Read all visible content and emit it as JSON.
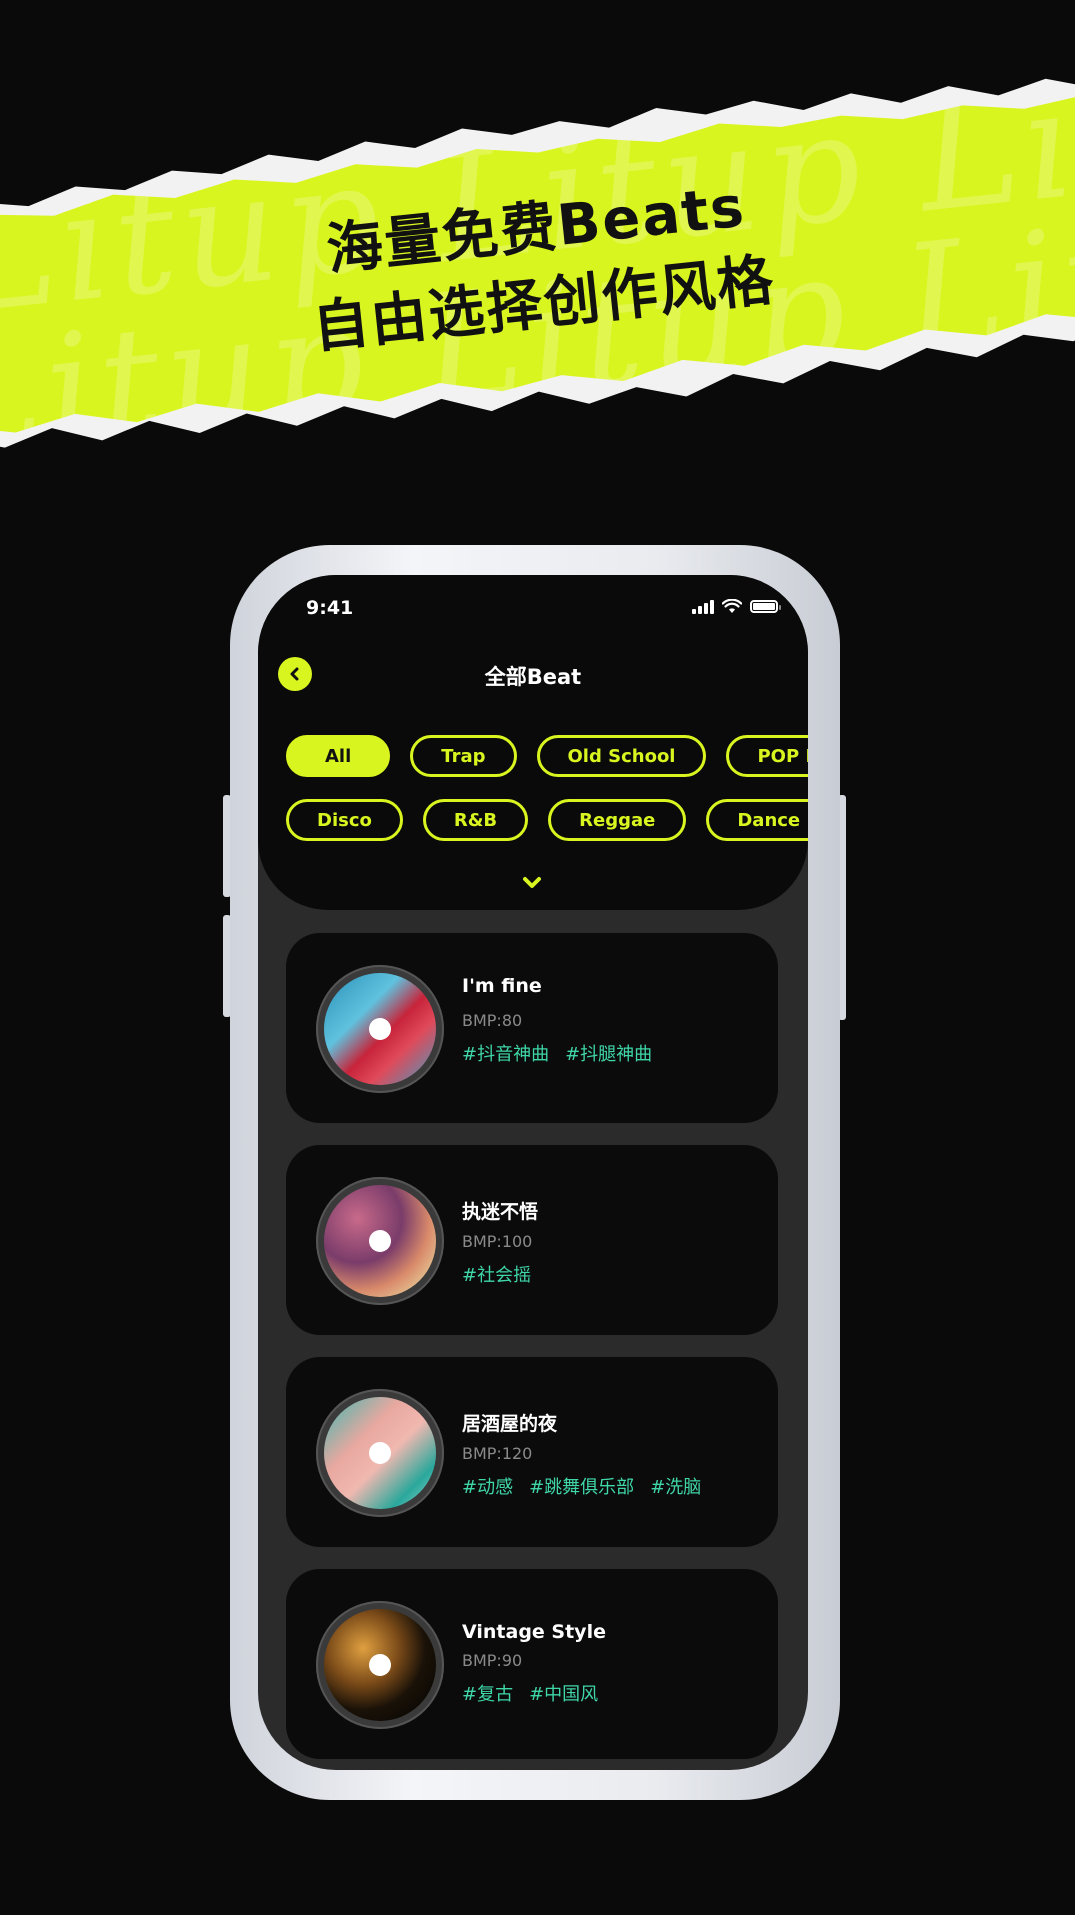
{
  "banner": {
    "line1": "海量免费Beats",
    "line2": "自由选择创作风格",
    "watermark": "Litup Litup Litup"
  },
  "status_bar": {
    "time": "9:41",
    "icons": [
      "signal-icon",
      "wifi-icon",
      "battery-icon"
    ]
  },
  "header": {
    "back_icon": "chevron-left-icon",
    "title": "全部Beat"
  },
  "filters": {
    "row1": [
      {
        "label": "All",
        "active": true
      },
      {
        "label": "Trap",
        "active": false
      },
      {
        "label": "Old School",
        "active": false
      },
      {
        "label": "POP R",
        "active": false
      }
    ],
    "row2": [
      {
        "label": "Disco",
        "active": false
      },
      {
        "label": "R&B",
        "active": false
      },
      {
        "label": "Reggae",
        "active": false
      },
      {
        "label": "Dance R",
        "active": false
      }
    ],
    "expand_icon": "chevron-down-icon"
  },
  "beats": [
    {
      "title": "I'm fine",
      "bmp": "BMP:80",
      "tags": [
        "#抖音神曲",
        "#抖腿神曲"
      ]
    },
    {
      "title": "执迷不悟",
      "bmp": "BMP:100",
      "tags": [
        "#社会摇"
      ]
    },
    {
      "title": "居酒屋的夜",
      "bmp": "BMP:120",
      "tags": [
        "#动感",
        "#跳舞俱乐部",
        "#洗脑"
      ]
    },
    {
      "title": "Vintage Style",
      "bmp": "BMP:90",
      "tags": [
        "#复古",
        "#中国风"
      ]
    }
  ],
  "colors": {
    "accent": "#d9f51f",
    "tag": "#3fd6a8",
    "background": "#0a0a0a"
  }
}
